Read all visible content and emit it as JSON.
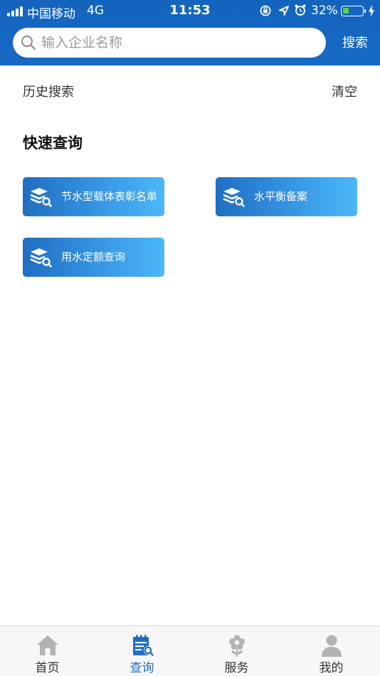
{
  "status_bar": {
    "carrier": "中国移动",
    "network": "4G",
    "time": "11:53",
    "battery_percent": "32%",
    "battery_level": 0.32,
    "icons": [
      "orientation-lock-icon",
      "location-arrow-icon",
      "alarm-icon",
      "battery-icon",
      "charging-bolt-icon"
    ]
  },
  "search": {
    "placeholder": "输入企业名称",
    "value": "",
    "button_label": "搜索"
  },
  "history": {
    "title": "历史搜索",
    "clear_label": "清空"
  },
  "quick_query": {
    "title": "快速查询",
    "items": [
      {
        "label": "节水型载体表彰名单",
        "icon": "database-search-icon"
      },
      {
        "label": "水平衡备案",
        "icon": "database-search-icon"
      },
      {
        "label": "用水定额查询",
        "icon": "database-search-icon"
      }
    ]
  },
  "tabbar": {
    "tabs": [
      {
        "label": "首页",
        "icon": "home-icon",
        "active": false
      },
      {
        "label": "查询",
        "icon": "calendar-search-icon",
        "active": true
      },
      {
        "label": "服务",
        "icon": "flower-icon",
        "active": false
      },
      {
        "label": "我的",
        "icon": "user-icon",
        "active": false
      }
    ]
  },
  "colors": {
    "header_blue": "#1669c4",
    "accent_blue": "#1f6ec2",
    "gradient_light": "#4bb8f8",
    "inactive_icon": "#b3b3b3",
    "battery_green": "#5bd34a"
  }
}
